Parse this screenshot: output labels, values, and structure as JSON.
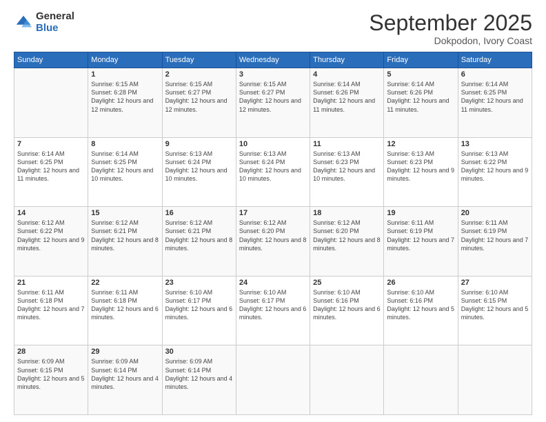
{
  "logo": {
    "general": "General",
    "blue": "Blue"
  },
  "header": {
    "month": "September 2025",
    "location": "Dokpodon, Ivory Coast"
  },
  "weekdays": [
    "Sunday",
    "Monday",
    "Tuesday",
    "Wednesday",
    "Thursday",
    "Friday",
    "Saturday"
  ],
  "weeks": [
    [
      {
        "day": "",
        "sunrise": "",
        "sunset": "",
        "daylight": ""
      },
      {
        "day": "1",
        "sunrise": "Sunrise: 6:15 AM",
        "sunset": "Sunset: 6:28 PM",
        "daylight": "Daylight: 12 hours and 12 minutes."
      },
      {
        "day": "2",
        "sunrise": "Sunrise: 6:15 AM",
        "sunset": "Sunset: 6:27 PM",
        "daylight": "Daylight: 12 hours and 12 minutes."
      },
      {
        "day": "3",
        "sunrise": "Sunrise: 6:15 AM",
        "sunset": "Sunset: 6:27 PM",
        "daylight": "Daylight: 12 hours and 12 minutes."
      },
      {
        "day": "4",
        "sunrise": "Sunrise: 6:14 AM",
        "sunset": "Sunset: 6:26 PM",
        "daylight": "Daylight: 12 hours and 11 minutes."
      },
      {
        "day": "5",
        "sunrise": "Sunrise: 6:14 AM",
        "sunset": "Sunset: 6:26 PM",
        "daylight": "Daylight: 12 hours and 11 minutes."
      },
      {
        "day": "6",
        "sunrise": "Sunrise: 6:14 AM",
        "sunset": "Sunset: 6:25 PM",
        "daylight": "Daylight: 12 hours and 11 minutes."
      }
    ],
    [
      {
        "day": "7",
        "sunrise": "Sunrise: 6:14 AM",
        "sunset": "Sunset: 6:25 PM",
        "daylight": "Daylight: 12 hours and 11 minutes."
      },
      {
        "day": "8",
        "sunrise": "Sunrise: 6:14 AM",
        "sunset": "Sunset: 6:25 PM",
        "daylight": "Daylight: 12 hours and 10 minutes."
      },
      {
        "day": "9",
        "sunrise": "Sunrise: 6:13 AM",
        "sunset": "Sunset: 6:24 PM",
        "daylight": "Daylight: 12 hours and 10 minutes."
      },
      {
        "day": "10",
        "sunrise": "Sunrise: 6:13 AM",
        "sunset": "Sunset: 6:24 PM",
        "daylight": "Daylight: 12 hours and 10 minutes."
      },
      {
        "day": "11",
        "sunrise": "Sunrise: 6:13 AM",
        "sunset": "Sunset: 6:23 PM",
        "daylight": "Daylight: 12 hours and 10 minutes."
      },
      {
        "day": "12",
        "sunrise": "Sunrise: 6:13 AM",
        "sunset": "Sunset: 6:23 PM",
        "daylight": "Daylight: 12 hours and 9 minutes."
      },
      {
        "day": "13",
        "sunrise": "Sunrise: 6:13 AM",
        "sunset": "Sunset: 6:22 PM",
        "daylight": "Daylight: 12 hours and 9 minutes."
      }
    ],
    [
      {
        "day": "14",
        "sunrise": "Sunrise: 6:12 AM",
        "sunset": "Sunset: 6:22 PM",
        "daylight": "Daylight: 12 hours and 9 minutes."
      },
      {
        "day": "15",
        "sunrise": "Sunrise: 6:12 AM",
        "sunset": "Sunset: 6:21 PM",
        "daylight": "Daylight: 12 hours and 8 minutes."
      },
      {
        "day": "16",
        "sunrise": "Sunrise: 6:12 AM",
        "sunset": "Sunset: 6:21 PM",
        "daylight": "Daylight: 12 hours and 8 minutes."
      },
      {
        "day": "17",
        "sunrise": "Sunrise: 6:12 AM",
        "sunset": "Sunset: 6:20 PM",
        "daylight": "Daylight: 12 hours and 8 minutes."
      },
      {
        "day": "18",
        "sunrise": "Sunrise: 6:12 AM",
        "sunset": "Sunset: 6:20 PM",
        "daylight": "Daylight: 12 hours and 8 minutes."
      },
      {
        "day": "19",
        "sunrise": "Sunrise: 6:11 AM",
        "sunset": "Sunset: 6:19 PM",
        "daylight": "Daylight: 12 hours and 7 minutes."
      },
      {
        "day": "20",
        "sunrise": "Sunrise: 6:11 AM",
        "sunset": "Sunset: 6:19 PM",
        "daylight": "Daylight: 12 hours and 7 minutes."
      }
    ],
    [
      {
        "day": "21",
        "sunrise": "Sunrise: 6:11 AM",
        "sunset": "Sunset: 6:18 PM",
        "daylight": "Daylight: 12 hours and 7 minutes."
      },
      {
        "day": "22",
        "sunrise": "Sunrise: 6:11 AM",
        "sunset": "Sunset: 6:18 PM",
        "daylight": "Daylight: 12 hours and 6 minutes."
      },
      {
        "day": "23",
        "sunrise": "Sunrise: 6:10 AM",
        "sunset": "Sunset: 6:17 PM",
        "daylight": "Daylight: 12 hours and 6 minutes."
      },
      {
        "day": "24",
        "sunrise": "Sunrise: 6:10 AM",
        "sunset": "Sunset: 6:17 PM",
        "daylight": "Daylight: 12 hours and 6 minutes."
      },
      {
        "day": "25",
        "sunrise": "Sunrise: 6:10 AM",
        "sunset": "Sunset: 6:16 PM",
        "daylight": "Daylight: 12 hours and 6 minutes."
      },
      {
        "day": "26",
        "sunrise": "Sunrise: 6:10 AM",
        "sunset": "Sunset: 6:16 PM",
        "daylight": "Daylight: 12 hours and 5 minutes."
      },
      {
        "day": "27",
        "sunrise": "Sunrise: 6:10 AM",
        "sunset": "Sunset: 6:15 PM",
        "daylight": "Daylight: 12 hours and 5 minutes."
      }
    ],
    [
      {
        "day": "28",
        "sunrise": "Sunrise: 6:09 AM",
        "sunset": "Sunset: 6:15 PM",
        "daylight": "Daylight: 12 hours and 5 minutes."
      },
      {
        "day": "29",
        "sunrise": "Sunrise: 6:09 AM",
        "sunset": "Sunset: 6:14 PM",
        "daylight": "Daylight: 12 hours and 4 minutes."
      },
      {
        "day": "30",
        "sunrise": "Sunrise: 6:09 AM",
        "sunset": "Sunset: 6:14 PM",
        "daylight": "Daylight: 12 hours and 4 minutes."
      },
      {
        "day": "",
        "sunrise": "",
        "sunset": "",
        "daylight": ""
      },
      {
        "day": "",
        "sunrise": "",
        "sunset": "",
        "daylight": ""
      },
      {
        "day": "",
        "sunrise": "",
        "sunset": "",
        "daylight": ""
      },
      {
        "day": "",
        "sunrise": "",
        "sunset": "",
        "daylight": ""
      }
    ]
  ]
}
